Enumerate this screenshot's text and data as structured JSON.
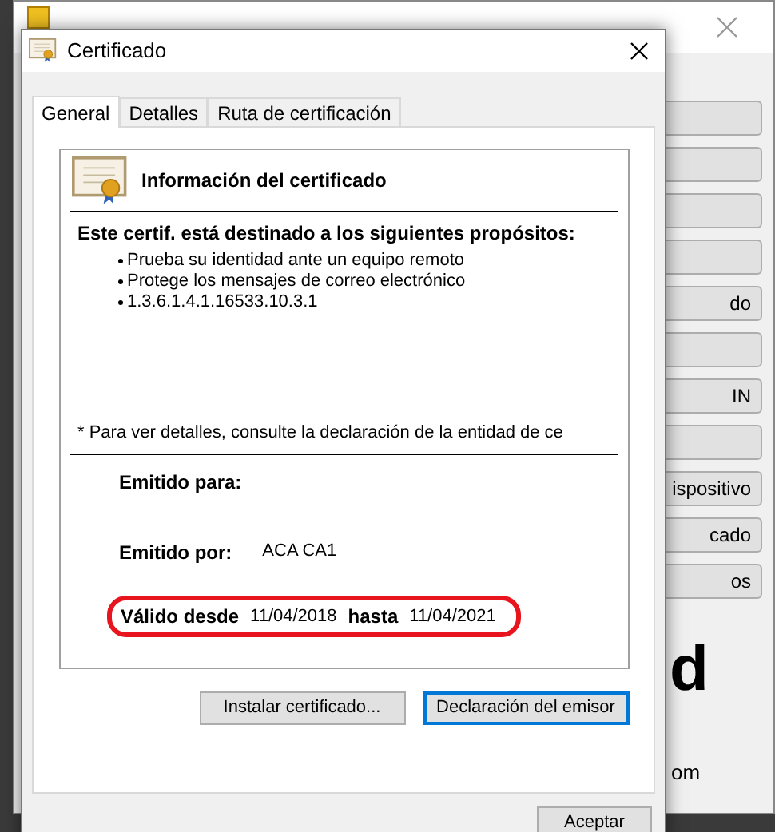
{
  "background_window": {
    "side_buttons": [
      {
        "kind": "blank"
      },
      {
        "kind": "blank"
      },
      {
        "kind": "blank"
      },
      {
        "kind": "blank"
      },
      {
        "kind": "text",
        "label": "do"
      },
      {
        "kind": "blank"
      },
      {
        "kind": "text",
        "label": "IN"
      },
      {
        "kind": "blank"
      },
      {
        "kind": "text",
        "label": "ispositivo"
      },
      {
        "kind": "text",
        "label": "cado"
      },
      {
        "kind": "text",
        "label": "os"
      }
    ],
    "logo_fragment": "d",
    "url_fragment": "om"
  },
  "dialog": {
    "title": "Certificado",
    "tabs": [
      {
        "label": "General",
        "selected": true
      },
      {
        "label": "Detalles",
        "selected": false
      },
      {
        "label": "Ruta de certificación",
        "selected": false
      }
    ],
    "info_title": "Información del certificado",
    "purposes_heading": "Este certif. está destinado a los siguientes propósitos:",
    "purposes": [
      "Prueba su identidad ante un equipo remoto",
      "Protege los mensajes de correo electrónico",
      "1.3.6.1.4.1.16533.10.3.1"
    ],
    "note": "* Para ver detalles, consulte la declaración de la entidad de ce",
    "issued_to_label": "Emitido para:",
    "issued_by_label": "Emitido por:",
    "issued_by": "ACA CA1",
    "valid_from_label": "Válido desde",
    "valid_from": "11/04/2018",
    "valid_to_label": "hasta",
    "valid_to": "11/04/2021",
    "buttons": [
      {
        "label": "Instalar certificado...",
        "focused": false
      },
      {
        "label": "Declaración del emisor",
        "focused": true
      }
    ],
    "ok_button": "Aceptar"
  }
}
